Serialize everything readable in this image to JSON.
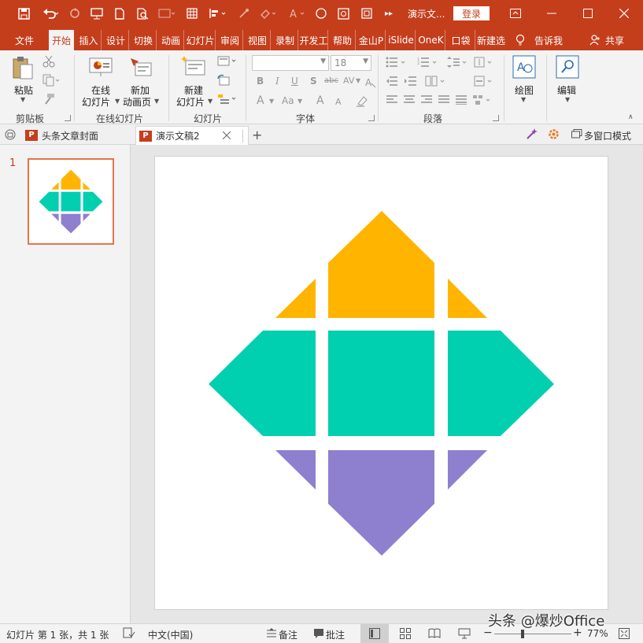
{
  "window": {
    "doc_title": "演示文...",
    "login_label": "登录"
  },
  "ribbon_tabs": [
    {
      "label": "文件"
    },
    {
      "label": "开始"
    },
    {
      "label": "插入"
    },
    {
      "label": "设计"
    },
    {
      "label": "切换"
    },
    {
      "label": "动画"
    },
    {
      "label": "幻灯片"
    },
    {
      "label": "审阅"
    },
    {
      "label": "视图"
    },
    {
      "label": "录制"
    },
    {
      "label": "开发工"
    },
    {
      "label": "帮助"
    },
    {
      "label": "金山P"
    },
    {
      "label": "iSlide"
    },
    {
      "label": "OneK"
    },
    {
      "label": "口袋"
    },
    {
      "label": "新建选"
    }
  ],
  "tell_me": "告诉我",
  "share": "共享",
  "ribbon": {
    "paste": "粘贴",
    "online_slide_1": "在线",
    "online_slide_2": "幻灯片",
    "add_anim_1": "新加",
    "add_anim_2": "动画页",
    "new_slide_1": "新建",
    "new_slide_2": "幻灯片",
    "font_size": "18",
    "draw": "绘图",
    "edit": "编辑",
    "groups": {
      "clipboard": "剪贴板",
      "online_slides": "在线幻灯片",
      "slides": "幻灯片",
      "font": "字体",
      "paragraph": "段落"
    },
    "font_buttons": {
      "bold": "B",
      "italic": "I",
      "underline": "U",
      "shadow": "S",
      "strike": "abc",
      "spacing": "AV",
      "font_color": "A",
      "case": "Aa",
      "grow": "A",
      "shrink": "A"
    }
  },
  "doc_tabs": [
    {
      "label": "头条文章封面"
    },
    {
      "label": "演示文稿2"
    }
  ],
  "multi_window": "多窗口模式",
  "thumbnail": {
    "number": "1",
    "border_color": "#e8734a"
  },
  "slide": {
    "colors": {
      "yellow": "#ffb400",
      "teal": "#00cfb0",
      "purple": "#8f7fcf"
    }
  },
  "status": {
    "slide_info": "幻灯片 第 1 张，共 1 张",
    "language": "中文(中国)",
    "notes": "备注",
    "comments": "批注",
    "zoom": "77%",
    "watermark": "头条 @爆炒Office"
  }
}
